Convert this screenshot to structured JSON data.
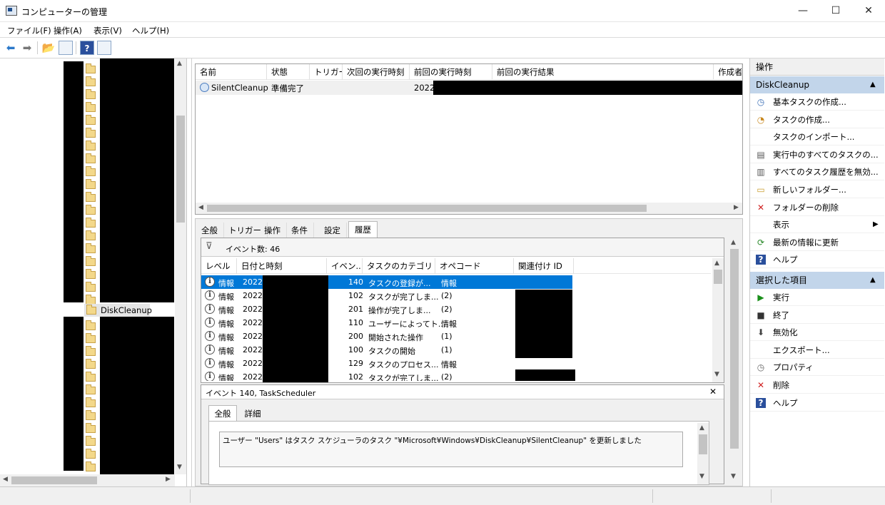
{
  "window": {
    "title": "コンピューターの管理",
    "minimize": "—",
    "maximize": "☐",
    "close": "✕"
  },
  "menu": {
    "file": "ファイル(F)",
    "action": "操作(A)",
    "view": "表示(V)",
    "help": "ヘルプ(H)"
  },
  "tree": {
    "selected_label": "DiskCleanup"
  },
  "task_table": {
    "columns": [
      "名前",
      "状態",
      "トリガー",
      "次回の実行時刻",
      "前回の実行時刻",
      "前回の実行結果",
      "作成者"
    ],
    "row": {
      "name": "SilentCleanup",
      "status": "準備完了",
      "last_run": "2022"
    }
  },
  "tabs": [
    "全般",
    "トリガー",
    "操作",
    "条件",
    "設定",
    "履歴"
  ],
  "history": {
    "filter_label": "イベント数: 46",
    "columns": [
      "レベル",
      "日付と時刻",
      "イベン...",
      "タスクのカテゴリ",
      "オペコード",
      "関連付け ID"
    ],
    "rows": [
      {
        "level": "情報",
        "date": "2022/",
        "id": "140",
        "category": "タスクの登録が...",
        "opcode": "情報"
      },
      {
        "level": "情報",
        "date": "2022/",
        "id": "102",
        "category": "タスクが完了しま...",
        "opcode": "(2)"
      },
      {
        "level": "情報",
        "date": "2022/",
        "id": "201",
        "category": "操作が完了しま...",
        "opcode": "(2)"
      },
      {
        "level": "情報",
        "date": "2022/",
        "id": "110",
        "category": "ユーザーによってト...",
        "opcode": "情報"
      },
      {
        "level": "情報",
        "date": "2022/",
        "id": "200",
        "category": "開始された操作",
        "opcode": "(1)"
      },
      {
        "level": "情報",
        "date": "2022/",
        "id": "100",
        "category": "タスクの開始",
        "opcode": "(1)"
      },
      {
        "level": "情報",
        "date": "2022/",
        "id": "129",
        "category": "タスクのプロセス...",
        "opcode": "情報"
      },
      {
        "level": "情報",
        "date": "2022/",
        "id": "102",
        "category": "タスクが完了しま...",
        "opcode": "(2)"
      }
    ]
  },
  "event_detail": {
    "title": "イベント 140, TaskScheduler",
    "close": "✕",
    "tabs": [
      "全般",
      "詳細"
    ],
    "message": "ユーザー \"Users\" はタスク スケジューラのタスク \"¥Microsoft¥Windows¥DiskCleanup¥SilentCleanup\" を更新しました"
  },
  "actions": {
    "header": "操作",
    "section1": "DiskCleanup",
    "items1": [
      "基本タスクの作成...",
      "タスクの作成...",
      "タスクのインポート...",
      "実行中のすべてのタスクの...",
      "すべてのタスク履歴を無効...",
      "新しいフォルダー...",
      "フォルダーの削除",
      "表示",
      "最新の情報に更新",
      "ヘルプ"
    ],
    "section2": "選択した項目",
    "items2": [
      "実行",
      "終了",
      "無効化",
      "エクスポート...",
      "プロパティ",
      "削除",
      "ヘルプ"
    ]
  },
  "colors": {
    "selection": "#0078d7",
    "section_bg": "#c2d5ea"
  }
}
